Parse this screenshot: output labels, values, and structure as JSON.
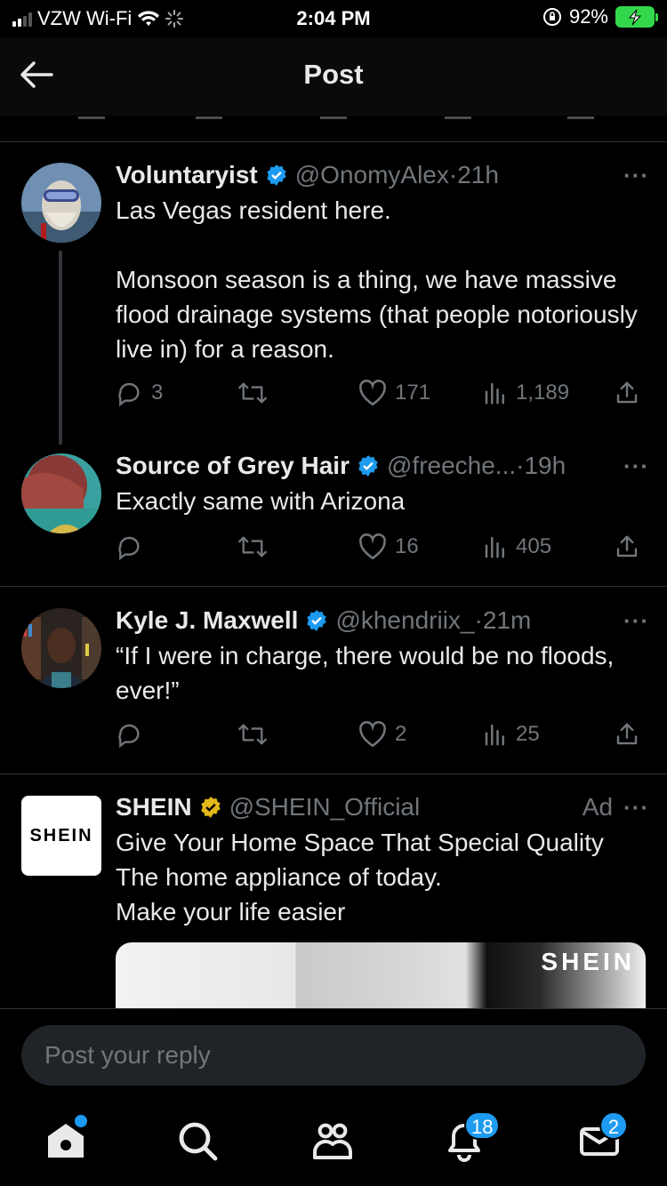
{
  "status_bar": {
    "carrier": "VZW Wi-Fi",
    "time": "2:04 PM",
    "battery": "92%"
  },
  "header": {
    "title": "Post"
  },
  "tweets": [
    {
      "name": "Voluntaryist",
      "handle": "@OnomyAlex",
      "time": "21h",
      "body": "Las Vegas resident here.\n\nMonsoon season is a thing, we have massive flood drainage systems (that people notoriously live in) for a reason.",
      "replies": "3",
      "retweets": "",
      "likes": "171",
      "views": "1,189"
    },
    {
      "name": "Source of Grey Hair",
      "handle": "@freeche...",
      "time": "19h",
      "body": "Exactly same with Arizona",
      "replies": "",
      "retweets": "",
      "likes": "16",
      "views": "405"
    },
    {
      "name": "Kyle J. Maxwell",
      "handle": "@khendriix_",
      "time": "21m",
      "body": "“If I were in charge, there would be no floods, ever!”",
      "replies": "",
      "retweets": "",
      "likes": "2",
      "views": "25"
    }
  ],
  "ad": {
    "name": "SHEIN",
    "handle": "@SHEIN_Official",
    "ad_label": "Ad",
    "logo_text": "SHEIN",
    "body": "Give Your Home Space That Special Quality\nThe home appliance of today.\nMake your life easier",
    "media_text": "SHEIN"
  },
  "reply": {
    "placeholder": "Post your reply"
  },
  "tabbar": {
    "notifications_badge": "18",
    "messages_badge": "2"
  },
  "colors": {
    "accent": "#1d9bf0",
    "gold_badge": "#e2b719",
    "battery": "#32d74b"
  }
}
